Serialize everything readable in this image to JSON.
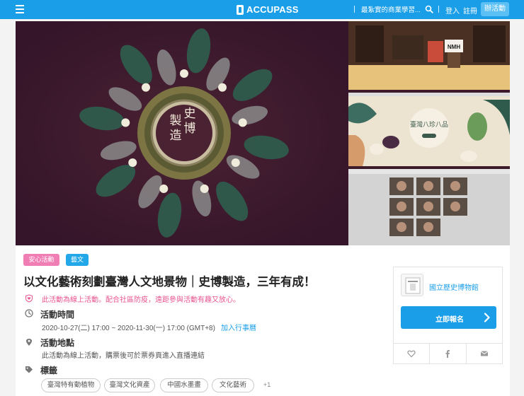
{
  "header": {
    "logo_text": "ACCUPASS",
    "search_text": "最紮實的商業學習...",
    "login": "登入",
    "register": "註冊",
    "host": "辦活動"
  },
  "hero": {
    "badge_text": [
      "史",
      "博",
      "製",
      "造"
    ],
    "exhibit_title": "臺灣八珍八品",
    "nmh_sign": "NMH"
  },
  "event": {
    "tags": [
      "安心活動",
      "藝文"
    ],
    "title": "以文化藝術刻劃臺灣人文地景物｜史博製造，三年有成！",
    "notice": "此活動為線上活動。配合社區防疫，遠距參與活動有趣又放心。",
    "time_title": "活動時間",
    "time_value": "2020-10-27(二) 17:00 ~ 2020-11-30(一) 17:00 (GMT+8)",
    "add_calendar": "加入行事曆",
    "location_title": "活動地點",
    "location_value": "此活動為線上活動，購票後可於票券頁進入直播連結",
    "tags_title": "標籤",
    "chips": [
      "臺灣特有動植物",
      "臺灣文化資產",
      "中國水墨畫",
      "文化藝術"
    ],
    "more": "+1"
  },
  "sidebar": {
    "org_name": "國立歷史博物館",
    "register_label": "立即報名"
  },
  "colors": {
    "brand": "#1a9ee8",
    "safe_tag": "#f07eb4",
    "art_tag": "#22a8e8",
    "notice": "#e85590"
  }
}
